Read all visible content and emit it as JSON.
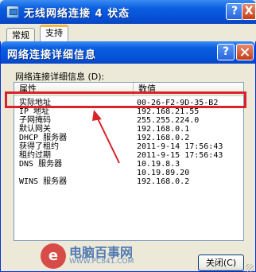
{
  "outer_window": {
    "title": "无线网络连接 4 状态",
    "help_label": "?",
    "close_label": "X",
    "tabs": [
      {
        "label": "常规"
      },
      {
        "label": "支持"
      }
    ]
  },
  "dialog": {
    "title": "网络连接详细信息",
    "help_label": "?",
    "details_label": "网络连接详细信息 (D):",
    "columns": [
      "属性",
      "数值"
    ],
    "rows": [
      {
        "prop": "实际地址",
        "value": "00-26-F2-9D-35-B2"
      },
      {
        "prop": "IP 地址",
        "value": "192.168.21.55"
      },
      {
        "prop": "子网掩码",
        "value": "255.255.224.0"
      },
      {
        "prop": "默认网关",
        "value": "192.168.0.1"
      },
      {
        "prop": "DHCP 服务器",
        "value": "192.168.0.2"
      },
      {
        "prop": "获得了租约",
        "value": "2011-9-14 17:56:43"
      },
      {
        "prop": "租约过期",
        "value": "2011-9-15 17:56:43"
      },
      {
        "prop": "DNS 服务器",
        "value": "10.19.8.3"
      },
      {
        "prop": "",
        "value": "10.19.89.20"
      },
      {
        "prop": "WINS 服务器",
        "value": "192.168.0.2"
      }
    ],
    "close_button_label": "关闭(C)"
  },
  "watermark": {
    "logo_letter": "e",
    "name": "电脑百事网",
    "url": "WWW.PC841.COM"
  },
  "colors": {
    "titlebar": "#0A5EE0",
    "highlight": "#D9232B",
    "window_bg": "#ECE9D8"
  }
}
